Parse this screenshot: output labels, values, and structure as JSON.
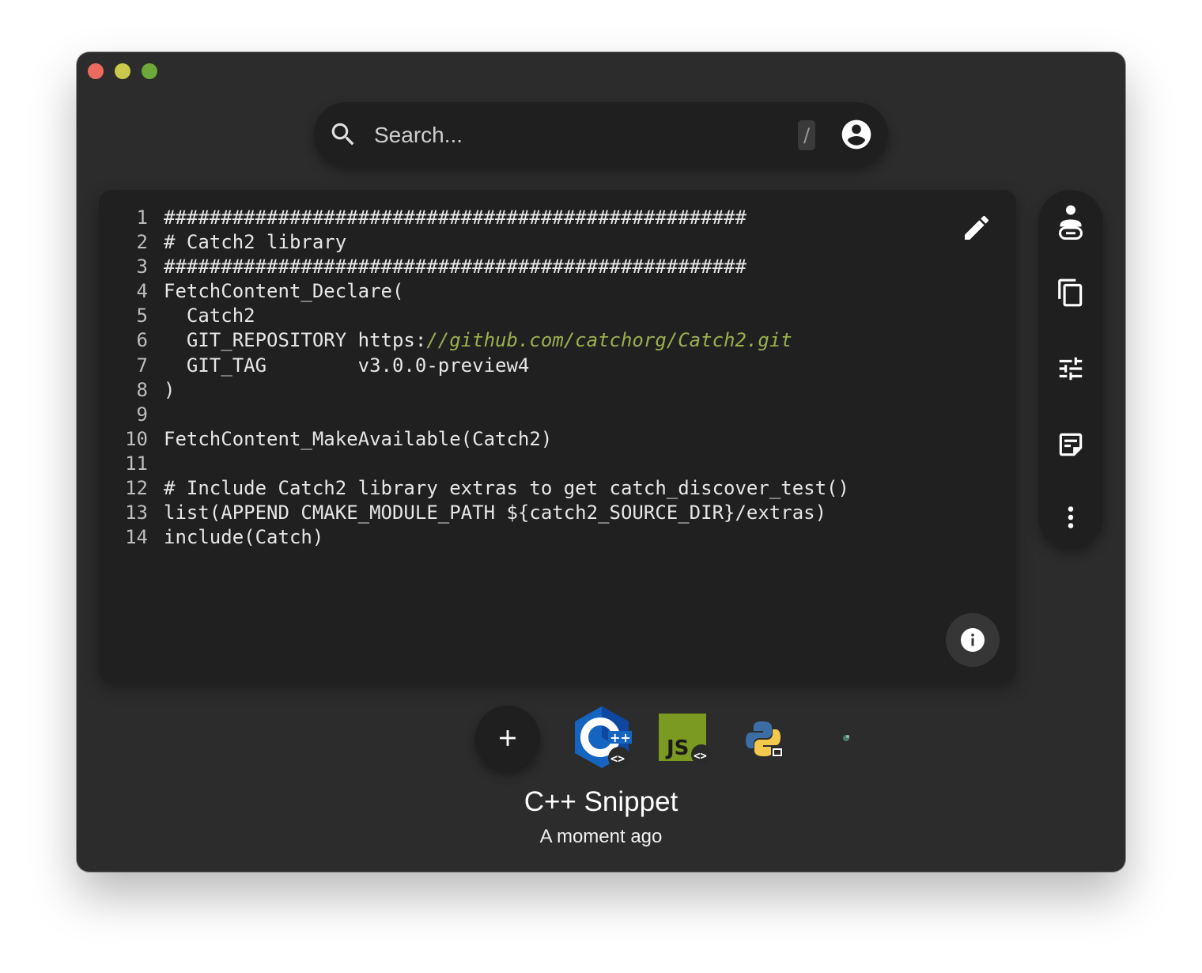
{
  "search": {
    "placeholder": "Search...",
    "shortcut": "/"
  },
  "code": {
    "lines": [
      "###################################################",
      "# Catch2 library",
      "###################################################",
      "FetchContent_Declare(",
      "  Catch2",
      "  GIT_REPOSITORY https:",
      "  GIT_TAG        v3.0.0-preview4",
      ")",
      "",
      "FetchContent_MakeAvailable(Catch2)",
      "",
      "# Include Catch2 library extras to get catch_discover_test()",
      "list(APPEND CMAKE_MODULE_PATH ${catch2_SOURCE_DIR}/extras)",
      "include(Catch)"
    ],
    "line6_url": "//github.com/catchorg/Catch2.git"
  },
  "toolbar": {
    "icons": [
      "share-person-icon",
      "copy-icon",
      "tune-icon",
      "notes-icon",
      "more-vert-icon"
    ]
  },
  "snippets": {
    "items": [
      "C++",
      "JS",
      "Python",
      "Other"
    ],
    "selected": "C++"
  },
  "current": {
    "title": "C++ Snippet",
    "time": "A moment ago"
  },
  "colors": {
    "window": "#2c2c2c",
    "editor": "#202020",
    "url": "#9ab04d",
    "cpp_blue": "#1565c0",
    "js_green": "#7a9a22"
  }
}
